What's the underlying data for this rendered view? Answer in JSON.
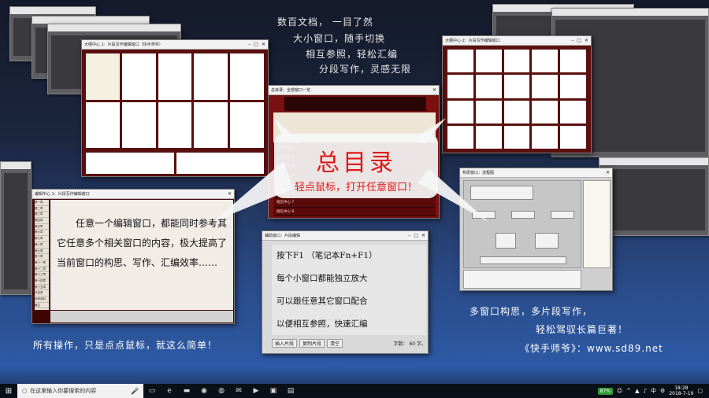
{
  "overlay": {
    "tagline": [
      "数百文档，  一目了然",
      "大小窗口，随手切换",
      "相互参照，轻松汇编",
      "分段写作，灵感无限"
    ],
    "bubble_title": "总目录",
    "bubble_sub": "轻点鼠标，打开任意窗口！",
    "left_caption": "所有操作，只是点点鼠标，就这么简单！",
    "right_caption1": "多窗口构思，多片段写作，",
    "right_caption2": "轻松驾驭长篇巨著！",
    "right_caption3": "《快手师爷》：www.sd89.net"
  },
  "left_editor": {
    "title": "编辑中心 1：片段写作编辑窗口",
    "text": "任意一个编辑窗口，都能同时参考其它任意多个相关窗口的内容，极大提高了当前窗口的构思、写作、汇编效率……",
    "side_items": [
      "第一章",
      "第二章",
      "第三章",
      "第四章",
      "第五章",
      "第六章",
      "第七章",
      "第八章",
      "第九章",
      "第十章",
      "第十一章",
      "第十二章",
      "第十三章",
      "第十四章",
      "第十五章",
      "总目录",
      "参考资料",
      "备注"
    ]
  },
  "center_window": {
    "title": "辅助窗口：片段编辑",
    "lines": [
      "按下F1 （笔记本Fn+F1）",
      "每个小窗口都能独立放大",
      "可以跟任意其它窗口配合",
      "以便相互参照，快速汇编"
    ],
    "status": "字数：   60 字。",
    "buttons": [
      "插入片段",
      "复制片段",
      "清空"
    ]
  },
  "toc_window": {
    "title": "总目录：全部窗口一览",
    "rows": [
      "短信中心 1",
      "短信中心 2",
      "短信中心 3",
      "短信中心 4",
      "短信中心 5",
      "短信中心 6",
      "短信中心 7",
      "短信中心 8"
    ]
  },
  "taskbar": {
    "search_placeholder": "在这里输入你要搜索的内容",
    "battery": "87%",
    "ime": "中",
    "time": "18:28",
    "date": "2018-7-19"
  }
}
